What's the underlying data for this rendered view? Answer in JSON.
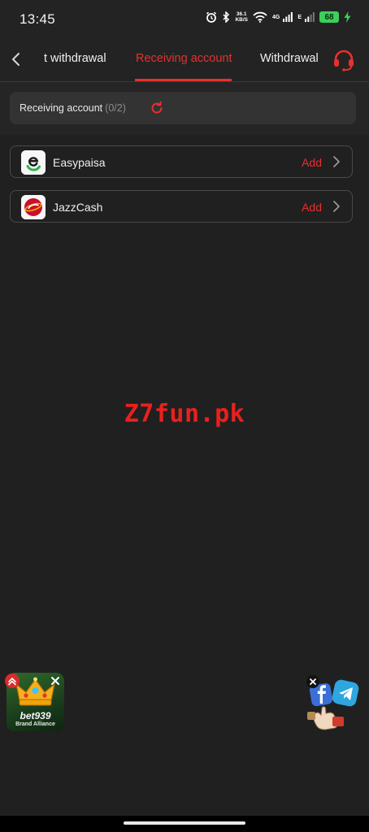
{
  "status_bar": {
    "time": "13:45",
    "net_speed": "36.1",
    "net_unit": "KB/S",
    "net_type": "4G",
    "net_type2": "E",
    "battery": "68",
    "icons": [
      "alarm-icon",
      "bluetooth-icon",
      "wifi-icon",
      "signal-icon",
      "battery-icon",
      "charging-icon"
    ]
  },
  "header": {
    "tabs": [
      {
        "label": "t withdrawal"
      },
      {
        "label": "Receiving account"
      },
      {
        "label": "Withdrawal"
      }
    ],
    "active_tab": 1
  },
  "summary": {
    "label": "Receiving account",
    "count": "(0/2)"
  },
  "accounts": [
    {
      "name": "Easypaisa",
      "action": "Add",
      "logo": "easypaisa-logo"
    },
    {
      "name": "JazzCash",
      "action": "Add",
      "logo": "jazzcash-logo"
    }
  ],
  "watermark": "Z7fun.pk",
  "promo": {
    "brand": "bet939",
    "subtitle": "Brand Alliance"
  },
  "colors": {
    "accent": "#e8302f",
    "background": "#202020",
    "card": "#333333"
  }
}
